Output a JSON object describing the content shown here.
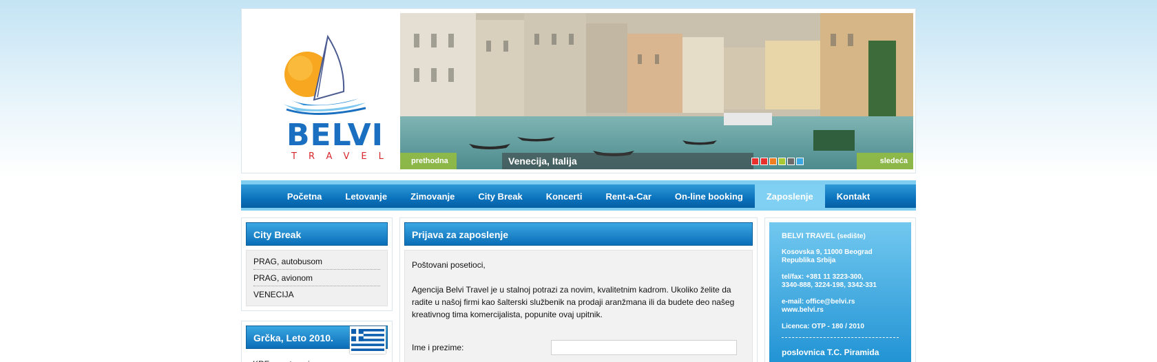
{
  "logo": {
    "word": "BELVI",
    "sub": "TRAVEL"
  },
  "banner": {
    "prev_label": "prethodna",
    "next_label": "sledeća",
    "caption": "Venecija, Italija",
    "dot_colors": [
      "#e8312f",
      "#e8312f",
      "#f07f22",
      "#a9c934",
      "#6b6b6b",
      "#3aa7e2"
    ]
  },
  "nav": {
    "items": [
      "Početna",
      "Letovanje",
      "Zimovanje",
      "City Break",
      "Koncerti",
      "Rent-a-Car",
      "On-line booking",
      "Zaposlenje",
      "Kontakt"
    ],
    "active": "Zaposlenje"
  },
  "left": {
    "city_break_title": "City Break",
    "city_break_items": [
      "PRAG, autobusom",
      "PRAG, avionom",
      "VENECIJA"
    ],
    "grcka_title": "Grčka, Leto 2010.",
    "grcka_items": [
      "KRF, apartmani"
    ]
  },
  "main": {
    "title": "Prijava za zaposlenje",
    "greeting": "Poštovani posetioci,",
    "body": "Agencija Belvi Travel je u stalnoj potrazi za novim, kvalitetnim kadrom. Ukoliko želite da radite u našoj firmi kao šalterski službenik na prodaji aranžmana ili da budete deo našeg kreativnog tima komercijalista, popunite ovaj upitnik.",
    "name_label": "Ime i prezime:"
  },
  "right": {
    "company": "BELVI TRAVEL",
    "company_note": "(sedište)",
    "address1": "Kosovska 9, 11000 Beograd",
    "address2": "Republika Srbija",
    "phone1": "tel/fax: +381 11 3223-300,",
    "phone2": "3340-888, 3224-198, 3342-331",
    "email": "e-mail: office@belvi.rs",
    "web": "www.belvi.rs",
    "license": "Licenca:  OTP - 180 / 2010",
    "branch": "poslovnica T.C. Piramida"
  }
}
